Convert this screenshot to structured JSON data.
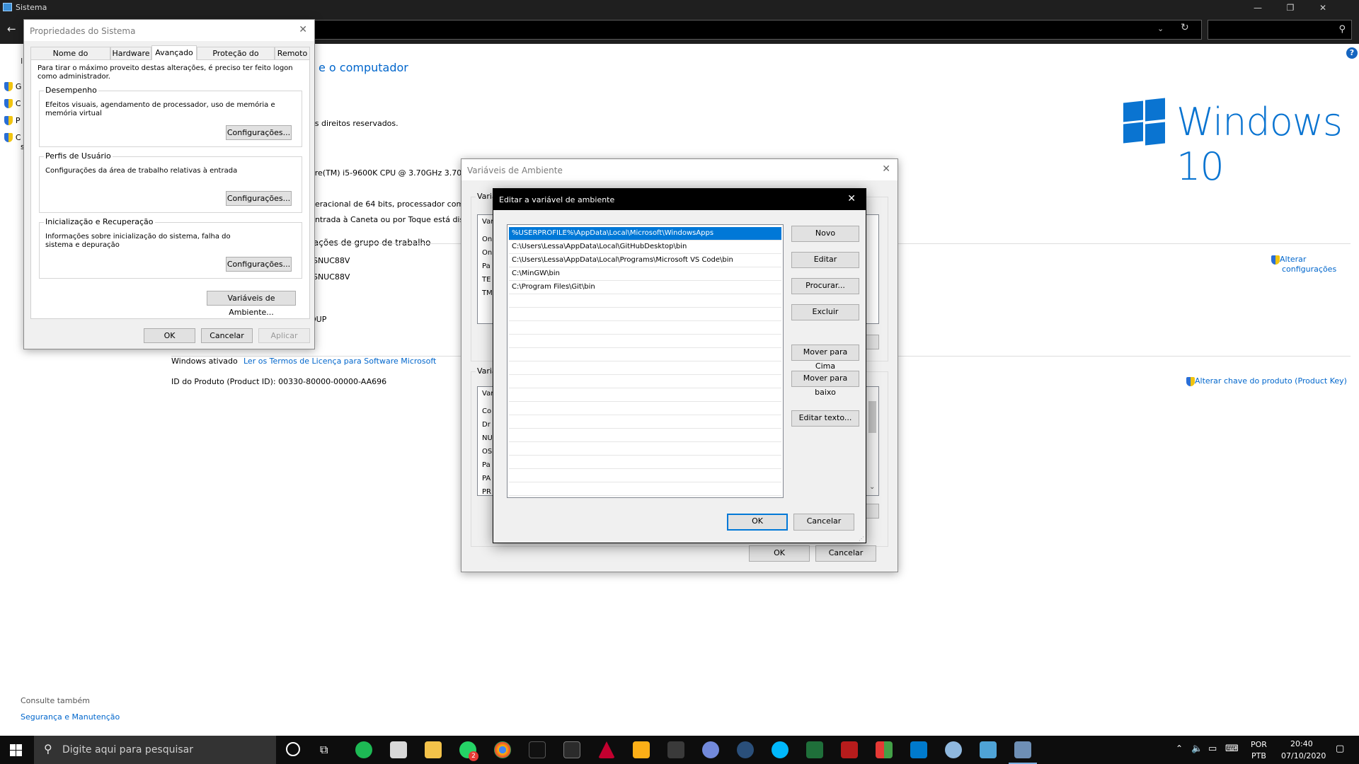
{
  "window": {
    "title": "Sistema",
    "caption_min": "—",
    "caption_restore": "❐",
    "caption_close": "✕"
  },
  "address": {
    "back": "←",
    "dropdown": "⌄",
    "refresh": "↻",
    "search_icon": "⚲"
  },
  "background": {
    "heading_fragment": "e o computador",
    "copyright_fragment": "os direitos reservados.",
    "cpu_fragment": "ore(TM) i5-9600K CPU @ 3.70GHz   3.70",
    "os_type_fragment": "peracional de 64 bits, processador com",
    "pen_fragment": "Entrada à Caneta ou por Toque está dis",
    "group_fragment": "rações de grupo de trabalho",
    "computer_name_1": "-SNUC88V",
    "computer_name_2": "-SNUC88V",
    "workgroup": "OUP",
    "left_letter": "I",
    "sidebar_letters": [
      "G",
      "C",
      "P",
      "C"
    ],
    "sidebar_sub": "s",
    "change_settings": [
      "Alterar",
      "configurações"
    ],
    "activation_label": "Windows ativado",
    "license_link": "Ler os Termos de Licença para Software Microsoft",
    "product_id": "ID do Produto (Product ID):  00330-80000-00000-AA696",
    "change_key": "Alterar chave do produto (Product Key)",
    "see_also": "Consulte também",
    "security_link": "Segurança e Manutenção",
    "help": "?",
    "win10_text": "Windows 10"
  },
  "sysprops": {
    "title": "Propriedades do Sistema",
    "close": "✕",
    "tabs": [
      "Nome do Computador",
      "Hardware",
      "Avançado",
      "Proteção do Sistema",
      "Remoto"
    ],
    "active_tab": "Avançado",
    "intro": "Para tirar o máximo proveito destas alterações, é preciso ter feito logon como administrador.",
    "groups": [
      {
        "legend": "Desempenho",
        "text": "Efeitos visuais, agendamento de processador, uso de memória e memória virtual",
        "button": "Configurações..."
      },
      {
        "legend": "Perfis de Usuário",
        "text": "Configurações da área de trabalho relativas à entrada",
        "button": "Configurações..."
      },
      {
        "legend": "Inicialização e Recuperação",
        "text": "Informações sobre inicialização do sistema, falha do sistema e depuração",
        "button": "Configurações..."
      }
    ],
    "env_button": "Variáveis de Ambiente...",
    "ok": "OK",
    "cancel": "Cancelar",
    "apply": "Aplicar"
  },
  "envvars": {
    "title": "Variáveis de Ambiente",
    "close": "✕",
    "user_group_fragment": "Variá",
    "user_list_header": "Vari",
    "user_rows": [
      "On",
      "On",
      "Pa",
      "TE",
      "TM"
    ],
    "sys_group_fragment": "Variá",
    "sys_list_header": "Var",
    "sys_rows": [
      "Co",
      "Dr",
      "NU",
      "OS",
      "Pa",
      "PA",
      "PR"
    ],
    "ok": "OK",
    "cancel": "Cancelar"
  },
  "editvar": {
    "title": "Editar a variável de ambiente",
    "close": "✕",
    "entries": [
      "%USERPROFILE%\\AppData\\Local\\Microsoft\\WindowsApps",
      "C:\\Users\\Lessa\\AppData\\Local\\GitHubDesktop\\bin",
      "C:\\Users\\Lessa\\AppData\\Local\\Programs\\Microsoft VS Code\\bin",
      "C:\\MinGW\\bin",
      "C:\\Program Files\\Git\\bin"
    ],
    "selected_index": 0,
    "buttons": [
      "Novo",
      "Editar",
      "Procurar...",
      "Excluir",
      "Mover para Cima",
      "Mover para baixo",
      "Editar texto..."
    ],
    "ok": "OK",
    "cancel": "Cancelar"
  },
  "taskbar": {
    "search_placeholder": "Digite aqui para pesquisar",
    "whatsapp_badge": "2",
    "lang_top": "POR",
    "lang_bottom": "PTB",
    "time": "20:40",
    "date": "07/10/2020"
  }
}
